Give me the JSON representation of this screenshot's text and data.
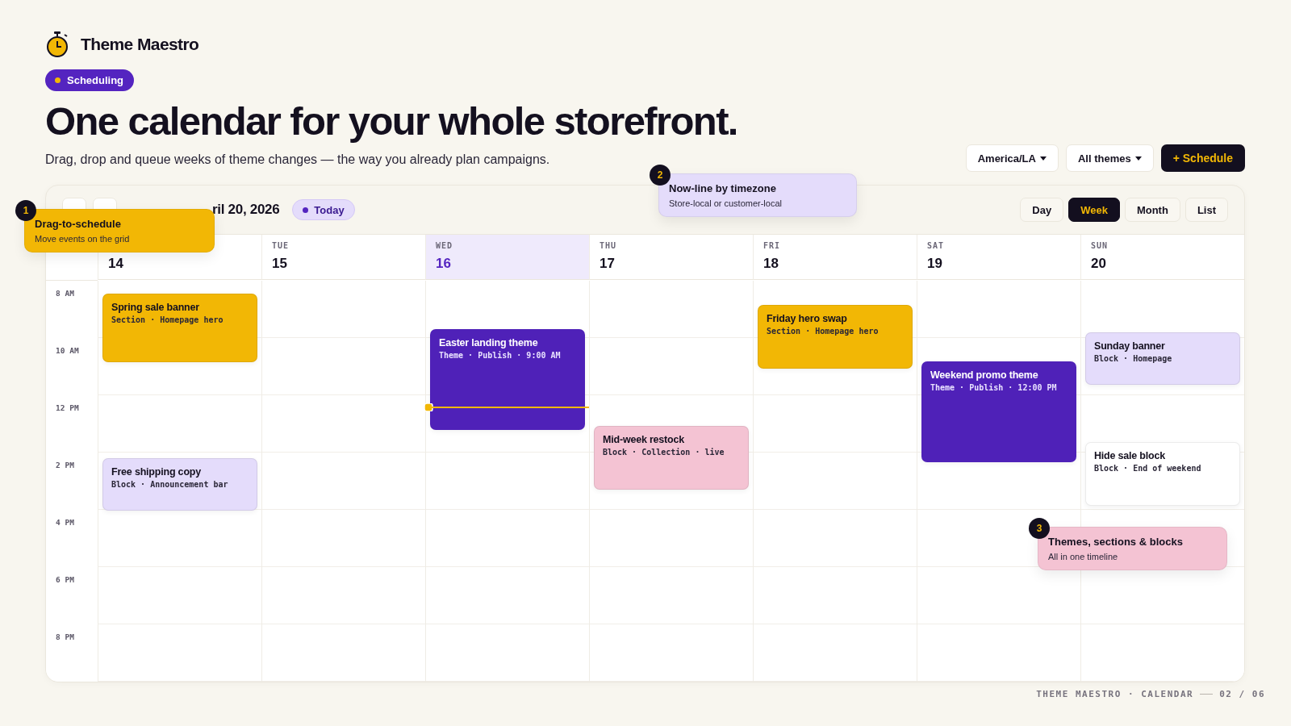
{
  "brand": {
    "name": "Theme Maestro"
  },
  "chip": {
    "label": "Scheduling"
  },
  "headline": "One calendar for your whole storefront.",
  "subtitle": "Drag, drop and queue weeks of theme changes — the way you already plan campaigns.",
  "filters": [
    {
      "label": "America/LA"
    },
    {
      "label": "All themes"
    }
  ],
  "primary_action": {
    "label": "+ Schedule"
  },
  "calendar": {
    "date_range": "ril 20, 2026",
    "today_label": "Today",
    "views": [
      {
        "label": "Day",
        "selected": false
      },
      {
        "label": "Week",
        "selected": true
      },
      {
        "label": "Month",
        "selected": false
      },
      {
        "label": "List",
        "selected": false
      }
    ],
    "hours": [
      "8 AM",
      "10 AM",
      "12 PM",
      "2 PM",
      "4 PM",
      "6 PM",
      "8 PM"
    ],
    "days": [
      {
        "date": "14",
        "today": false,
        "events": [
          {
            "title": "Spring sale banner",
            "meta": "Section · Homepage hero",
            "kind": "section",
            "color": "#f2b705"
          },
          {
            "title": "Free shipping copy",
            "meta": "Block · Announcement bar",
            "kind": "block",
            "color": "#e4dcfb"
          }
        ]
      },
      {
        "label": "TUE",
        "date": "15",
        "today": false
      },
      {
        "label": "WED",
        "date": "16",
        "today": true,
        "now_line": true,
        "events": [
          {
            "title": "Easter landing theme",
            "meta": "Theme · Publish · 9:00 AM",
            "kind": "theme",
            "color": "#4f21b8"
          }
        ]
      },
      {
        "label": "THU",
        "date": "17",
        "today": false,
        "events": [
          {
            "title": "Mid-week restock",
            "meta": "Block · Collection · live",
            "kind": "block",
            "color": "#f4c3d3"
          }
        ]
      },
      {
        "label": "FRI",
        "date": "18",
        "today": false,
        "events": [
          {
            "title": "Friday hero swap",
            "meta": "Section · Homepage hero",
            "kind": "section",
            "color": "#f2b705"
          }
        ]
      },
      {
        "label": "SAT",
        "date": "19",
        "today": false,
        "events": [
          {
            "title": "Weekend promo theme",
            "meta": "Theme · Publish · 12:00 PM",
            "kind": "theme",
            "color": "#4f21b8"
          }
        ]
      },
      {
        "label": "SUN",
        "date": "20",
        "today": false,
        "events": [
          {
            "title": "Sunday banner",
            "meta": "Block · Homepage",
            "kind": "block",
            "color": "#e4dcfb"
          },
          {
            "title": "Hide sale block",
            "meta": "Block · End of weekend",
            "kind": "block",
            "color": "#ffffff"
          }
        ]
      }
    ]
  },
  "callouts": [
    {
      "number": "1",
      "title": "Drag-to-schedule",
      "text": "Move events on the grid",
      "color": "#f2b705"
    },
    {
      "number": "2",
      "title": "Now-line by timezone",
      "text": "Store-local or customer-local",
      "color": "#e4dcfb"
    },
    {
      "number": "3",
      "title": "Themes, sections & blocks",
      "text": "All in one timeline",
      "color": "#f4c3d3"
    }
  ],
  "footer": {
    "label": "THEME MAESTRO · CALENDAR",
    "page": "02 / 06"
  }
}
